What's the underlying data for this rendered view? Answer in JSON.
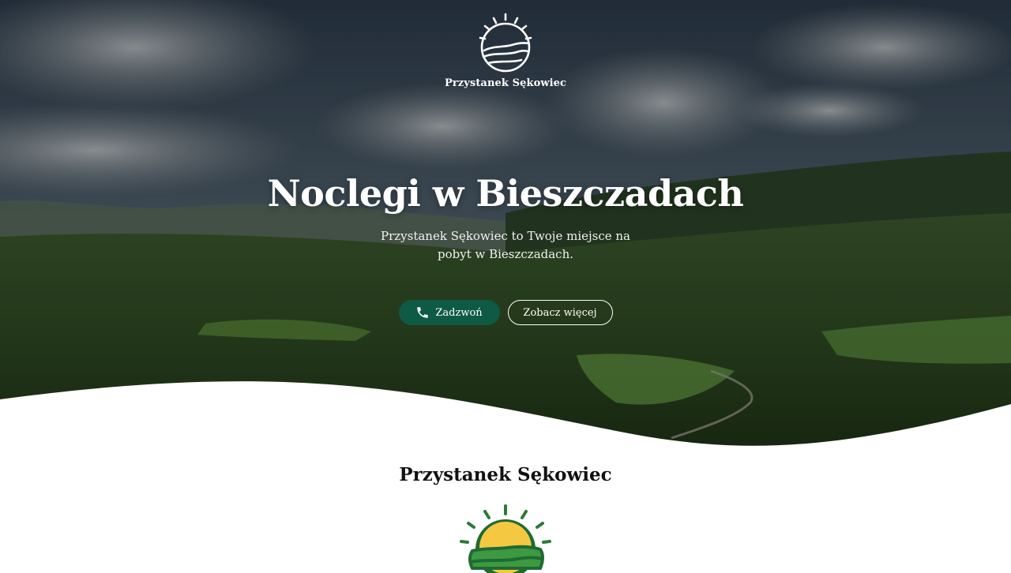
{
  "brand": {
    "name": "Przystanek Sękowiec",
    "logo_icon": "sun-over-hills-icon"
  },
  "hero": {
    "title": "Noclegi w Bieszczadach",
    "subtitle": "Przystanek Sękowiec to Twoje miejsce na pobyt w Bieszczadach.",
    "call_button": "Zadzwoń",
    "more_button": "Zobacz więcej",
    "call_icon": "phone-icon",
    "background": "mountain-valley-landscape-photo"
  },
  "about": {
    "title": "Przystanek Sękowiec",
    "logo_icon": "sun-over-hills-color-icon"
  },
  "colors": {
    "accent": "#0e5a44",
    "sun": "#f5c842",
    "hills": "#3e9a42",
    "text_dark": "#111111"
  }
}
